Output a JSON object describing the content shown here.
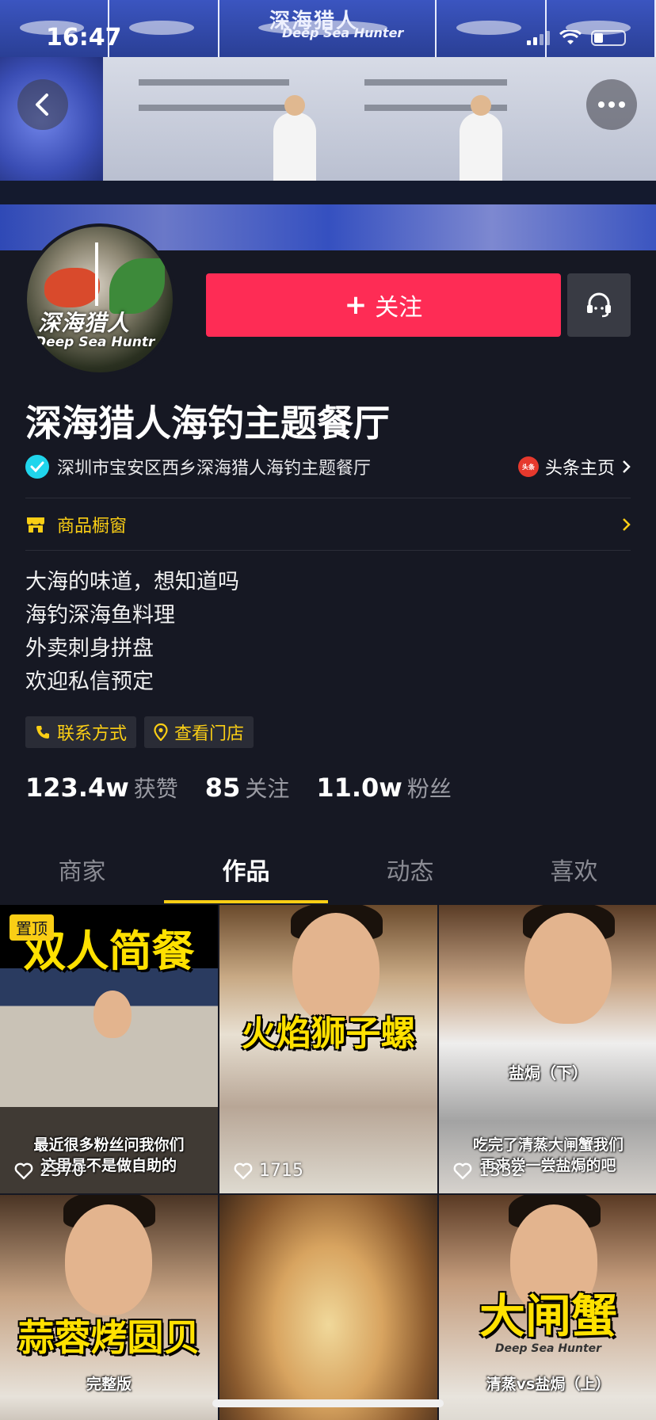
{
  "status_bar": {
    "time": "16:47",
    "battery_percent": 30
  },
  "banner": {
    "logo_text": "深海猎人",
    "logo_sub": "Deep Sea Hunter"
  },
  "avatar": {
    "logo_text": "深海猎人",
    "logo_sub": "Deep Sea Huntr"
  },
  "actions": {
    "follow_label": "关注",
    "follow_plus": "+"
  },
  "profile": {
    "name": "深海猎人海钓主题餐厅",
    "verification": "深圳市宝安区西乡深海猎人海钓主题餐厅",
    "toutiao_label": "头条主页",
    "toutiao_icon_text": "头条",
    "shop_label": "商品橱窗",
    "bio": [
      "大海的味道，想知道吗",
      "海钓深海鱼料理",
      "外卖刺身拼盘",
      "欢迎私信预定"
    ],
    "tags": [
      {
        "label": "联系方式",
        "icon": "phone-icon"
      },
      {
        "label": "查看门店",
        "icon": "location-pin-icon"
      }
    ],
    "stats": [
      {
        "num": "123.4w",
        "label": "获赞"
      },
      {
        "num": "85",
        "label": "关注"
      },
      {
        "num": "11.0w",
        "label": "粉丝"
      }
    ]
  },
  "tabs": [
    {
      "label": "商家",
      "active": false
    },
    {
      "label": "作品",
      "active": true
    },
    {
      "label": "动态",
      "active": false
    },
    {
      "label": "喜欢",
      "active": false
    }
  ],
  "videos": [
    {
      "pin": "置顶",
      "title": "双人简餐",
      "caption1": "最近很多粉丝问我你们",
      "caption2": "这里是不是做自助的",
      "likes": "2370"
    },
    {
      "title": "火焰狮子螺",
      "likes": "1715"
    },
    {
      "overlay": "盐焗（下）",
      "caption1": "吃完了清蒸大闸蟹我们",
      "caption2": "再来尝一尝盐焗的吧",
      "likes": "1332"
    },
    {
      "title": "蒜蓉烤圆贝",
      "caption1": "完整版"
    },
    {},
    {
      "title": "大闸蟹",
      "shirt": "Deep Sea Hunter",
      "caption1": "清蒸vs盐焗（上）"
    }
  ],
  "colors": {
    "background": "#161823",
    "follow": "#fe2c55",
    "accent": "#face15",
    "verified": "#20d5ec"
  }
}
